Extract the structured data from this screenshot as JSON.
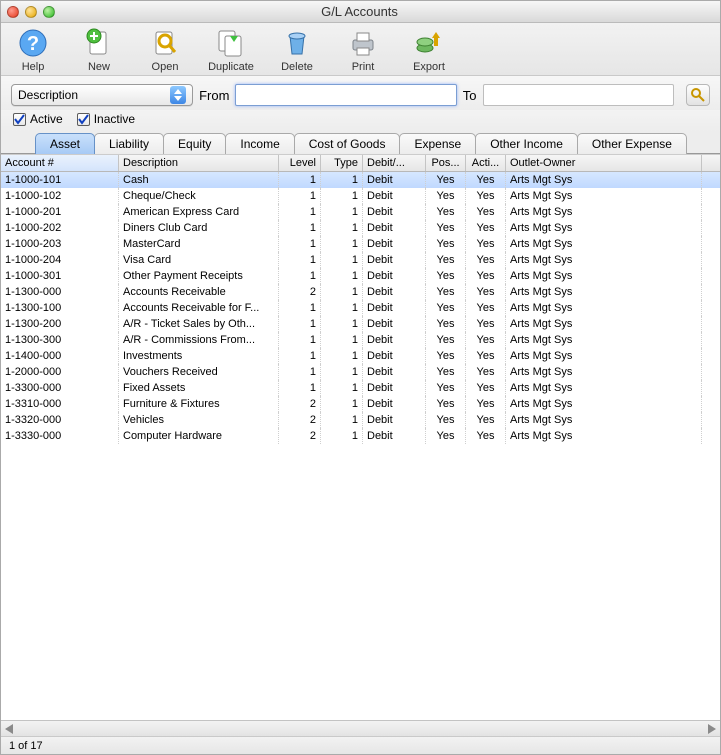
{
  "window": {
    "title": "G/L Accounts"
  },
  "toolbar": {
    "items": [
      {
        "id": "help",
        "label": "Help"
      },
      {
        "id": "new",
        "label": "New"
      },
      {
        "id": "open",
        "label": "Open"
      },
      {
        "id": "duplicate",
        "label": "Duplicate"
      },
      {
        "id": "delete",
        "label": "Delete"
      },
      {
        "id": "print",
        "label": "Print"
      },
      {
        "id": "export",
        "label": "Export"
      }
    ]
  },
  "filter": {
    "field_selector": "Description",
    "from_label": "From",
    "from_value": "",
    "to_label": "To",
    "to_value": ""
  },
  "checkboxes": {
    "active": {
      "label": "Active",
      "checked": true
    },
    "inactive": {
      "label": "Inactive",
      "checked": true
    }
  },
  "tabs": {
    "items": [
      {
        "label": "Asset",
        "active": true
      },
      {
        "label": "Liability",
        "active": false
      },
      {
        "label": "Equity",
        "active": false
      },
      {
        "label": "Income",
        "active": false
      },
      {
        "label": "Cost of Goods",
        "active": false
      },
      {
        "label": "Expense",
        "active": false
      },
      {
        "label": "Other Income",
        "active": false
      },
      {
        "label": "Other Expense",
        "active": false
      }
    ]
  },
  "grid": {
    "columns": [
      "Account #",
      "Description",
      "Level",
      "Type",
      "Debit/...",
      "Pos...",
      "Acti...",
      "Outlet-Owner"
    ],
    "sorted_column_index": 0,
    "rows": [
      {
        "selected": true,
        "acct": "1-1000-101",
        "desc": "Cash",
        "level": "1",
        "type": "1",
        "dc": "Debit",
        "pos": "Yes",
        "act": "Yes",
        "owner": "Arts Mgt Sys"
      },
      {
        "selected": false,
        "acct": "1-1000-102",
        "desc": "Cheque/Check",
        "level": "1",
        "type": "1",
        "dc": "Debit",
        "pos": "Yes",
        "act": "Yes",
        "owner": "Arts Mgt Sys"
      },
      {
        "selected": false,
        "acct": "1-1000-201",
        "desc": "American Express Card",
        "level": "1",
        "type": "1",
        "dc": "Debit",
        "pos": "Yes",
        "act": "Yes",
        "owner": "Arts Mgt Sys"
      },
      {
        "selected": false,
        "acct": "1-1000-202",
        "desc": "Diners Club Card",
        "level": "1",
        "type": "1",
        "dc": "Debit",
        "pos": "Yes",
        "act": "Yes",
        "owner": "Arts Mgt Sys"
      },
      {
        "selected": false,
        "acct": "1-1000-203",
        "desc": "MasterCard",
        "level": "1",
        "type": "1",
        "dc": "Debit",
        "pos": "Yes",
        "act": "Yes",
        "owner": "Arts Mgt Sys"
      },
      {
        "selected": false,
        "acct": "1-1000-204",
        "desc": "Visa Card",
        "level": "1",
        "type": "1",
        "dc": "Debit",
        "pos": "Yes",
        "act": "Yes",
        "owner": "Arts Mgt Sys"
      },
      {
        "selected": false,
        "acct": "1-1000-301",
        "desc": "Other Payment Receipts",
        "level": "1",
        "type": "1",
        "dc": "Debit",
        "pos": "Yes",
        "act": "Yes",
        "owner": "Arts Mgt Sys"
      },
      {
        "selected": false,
        "acct": "1-1300-000",
        "desc": "Accounts Receivable",
        "level": "2",
        "type": "1",
        "dc": "Debit",
        "pos": "Yes",
        "act": "Yes",
        "owner": "Arts Mgt Sys"
      },
      {
        "selected": false,
        "acct": "1-1300-100",
        "desc": "Accounts Receivable for F...",
        "level": "1",
        "type": "1",
        "dc": "Debit",
        "pos": "Yes",
        "act": "Yes",
        "owner": "Arts Mgt Sys"
      },
      {
        "selected": false,
        "acct": "1-1300-200",
        "desc": "A/R - Ticket Sales by Oth...",
        "level": "1",
        "type": "1",
        "dc": "Debit",
        "pos": "Yes",
        "act": "Yes",
        "owner": "Arts Mgt Sys"
      },
      {
        "selected": false,
        "acct": "1-1300-300",
        "desc": "A/R - Commissions From...",
        "level": "1",
        "type": "1",
        "dc": "Debit",
        "pos": "Yes",
        "act": "Yes",
        "owner": "Arts Mgt Sys"
      },
      {
        "selected": false,
        "acct": "1-1400-000",
        "desc": "Investments",
        "level": "1",
        "type": "1",
        "dc": "Debit",
        "pos": "Yes",
        "act": "Yes",
        "owner": "Arts Mgt Sys"
      },
      {
        "selected": false,
        "acct": "1-2000-000",
        "desc": "Vouchers Received",
        "level": "1",
        "type": "1",
        "dc": "Debit",
        "pos": "Yes",
        "act": "Yes",
        "owner": "Arts Mgt Sys"
      },
      {
        "selected": false,
        "acct": "1-3300-000",
        "desc": "Fixed Assets",
        "level": "1",
        "type": "1",
        "dc": "Debit",
        "pos": "Yes",
        "act": "Yes",
        "owner": "Arts Mgt Sys"
      },
      {
        "selected": false,
        "acct": "1-3310-000",
        "desc": "Furniture & Fixtures",
        "level": "2",
        "type": "1",
        "dc": "Debit",
        "pos": "Yes",
        "act": "Yes",
        "owner": "Arts Mgt Sys"
      },
      {
        "selected": false,
        "acct": "1-3320-000",
        "desc": "Vehicles",
        "level": "2",
        "type": "1",
        "dc": "Debit",
        "pos": "Yes",
        "act": "Yes",
        "owner": "Arts Mgt Sys"
      },
      {
        "selected": false,
        "acct": "1-3330-000",
        "desc": "Computer Hardware",
        "level": "2",
        "type": "1",
        "dc": "Debit",
        "pos": "Yes",
        "act": "Yes",
        "owner": "Arts Mgt Sys"
      }
    ]
  },
  "status": {
    "text": "1 of 17"
  }
}
